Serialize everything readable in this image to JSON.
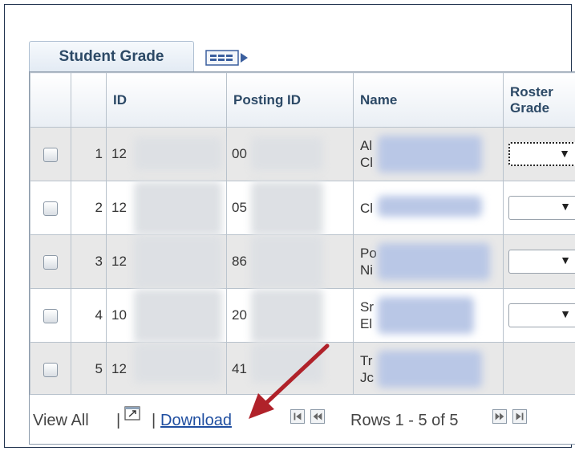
{
  "tab": {
    "title": "Student Grade"
  },
  "columns": {
    "id": "ID",
    "posting": "Posting ID",
    "name": "Name",
    "roster_line1": "Roster",
    "roster_line2": "Grade"
  },
  "rows": [
    {
      "num": "1",
      "id": "12",
      "posting": "00",
      "name1": "Al",
      "name2": "Cl",
      "dropdown": "▼"
    },
    {
      "num": "2",
      "id": "12",
      "posting": "05",
      "name1": "Cl",
      "name2": "",
      "dropdown": "▼"
    },
    {
      "num": "3",
      "id": "12",
      "posting": "86",
      "name1": "Po",
      "name2": "Ni",
      "dropdown": "▼"
    },
    {
      "num": "4",
      "id": "10",
      "posting": "20",
      "name1": "Sr",
      "name2": "El",
      "dropdown": "▼"
    },
    {
      "num": "5",
      "id": "12",
      "posting": "41",
      "name1": "Tr",
      "name2": "Jc",
      "dropdown": ""
    }
  ],
  "footer": {
    "view_all": "View All",
    "sep": "|",
    "download": "Download",
    "rows_text": "Rows 1 - 5 of 5"
  },
  "icons": {
    "grid_toggle": "grid-view-icon",
    "zoom": "zoom-window-icon",
    "first": "first-page-icon",
    "prev": "previous-page-icon",
    "next": "next-page-icon",
    "last": "last-page-icon"
  },
  "colors": {
    "header_text": "#2c4966",
    "link": "#1f4ea0",
    "annotation_arrow": "#b0222a"
  }
}
